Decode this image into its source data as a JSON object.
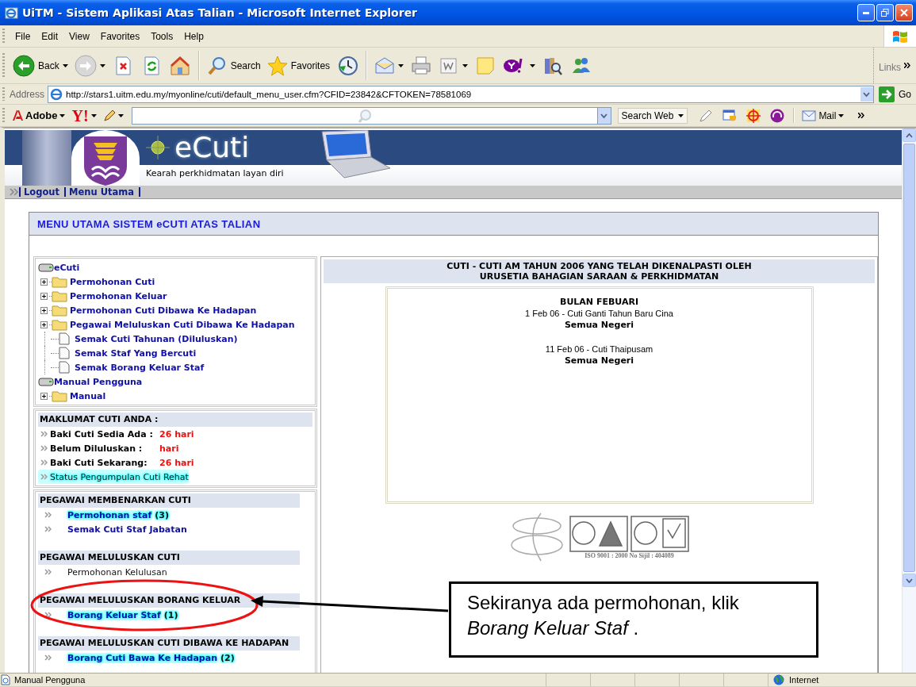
{
  "window": {
    "title": "UiTM - Sistem Aplikasi Atas Talian - Microsoft Internet Explorer"
  },
  "menu_bar": [
    "File",
    "Edit",
    "View",
    "Favorites",
    "Tools",
    "Help"
  ],
  "toolbar": {
    "back": "Back",
    "search": "Search",
    "favorites": "Favorites",
    "links": "Links"
  },
  "address_bar": {
    "label": "Address",
    "url": "http://stars1.uitm.edu.my/myonline/cuti/default_menu_user.cfm?CFID=23842&CFTOKEN=78581069",
    "go": "Go"
  },
  "search_toolbar": {
    "adobe": "Adobe",
    "yahoo": "Y!",
    "search_button": "Search Web",
    "mail": "Mail"
  },
  "banner": {
    "title": "eCuti",
    "tagline": "Kearah perkhidmatan layan diri"
  },
  "nav_links": [
    "Logout",
    "Menu Utama"
  ],
  "main": {
    "heading": "MENU UTAMA SISTEM eCUTI ATAS TALIAN"
  },
  "tree": [
    {
      "label": "eCuti",
      "kind": "drive",
      "children": [
        {
          "label": "Permohonan Cuti",
          "kind": "folder",
          "expanded": false
        },
        {
          "label": "Permohonan Keluar",
          "kind": "folder",
          "expanded": false
        },
        {
          "label": "Permohonan Cuti Dibawa Ke Hadapan",
          "kind": "folder",
          "expanded": false
        },
        {
          "label": "Pegawai Meluluskan Cuti Dibawa Ke Hadapan",
          "kind": "folder",
          "expanded": false
        },
        {
          "label": "Semak Cuti Tahunan (Diluluskan)",
          "kind": "page"
        },
        {
          "label": "Semak Staf Yang Bercuti",
          "kind": "page"
        },
        {
          "label": "Semak Borang Keluar Staf",
          "kind": "page"
        }
      ]
    },
    {
      "label": "Manual Pengguna",
      "kind": "drive",
      "children": [
        {
          "label": "Manual",
          "kind": "folder",
          "expanded": false
        }
      ]
    }
  ],
  "leave_info": {
    "heading": "MAKLUMAT CUTI ANDA :",
    "rows": [
      {
        "label": "Baki Cuti Sedia Ada :",
        "value": "26 hari"
      },
      {
        "label": "Belum Diluluskan :",
        "value": "hari"
      },
      {
        "label": "Baki Cuti Sekarang:",
        "value": "26 hari"
      }
    ],
    "link": "Status Pengumpulan Cuti Rehat"
  },
  "approver_sections": [
    {
      "heading": "PEGAWAI MEMBENARKAN CUTI",
      "items": [
        {
          "label": "Permohonan staf",
          "count": "(3)",
          "kind": "link",
          "highlighted": true
        },
        {
          "label": "Semak Cuti Staf Jabatan",
          "kind": "link",
          "highlighted": false
        }
      ]
    },
    {
      "heading": "PEGAWAI MELULUSKAN CUTI",
      "items": [
        {
          "label": "Permohonan Kelulusan",
          "kind": "plain",
          "highlighted": false
        }
      ]
    },
    {
      "heading": "PEGAWAI MELULUSKAN BORANG KELUAR",
      "items": [
        {
          "label": "Borang Keluar Staf",
          "count": "(1)",
          "kind": "link",
          "highlighted": true
        }
      ]
    },
    {
      "heading": "PEGAWAI MELULUSKAN CUTI DIBAWA KE HADAPAN",
      "items": [
        {
          "label": "Borang Cuti Bawa Ke Hadapan",
          "count": "(2)",
          "kind": "link",
          "highlighted": true
        }
      ]
    }
  ],
  "holidays": {
    "heading_lines": [
      "CUTI - CUTI AM TAHUN 2006 YANG TELAH DIKENALPASTI OLEH",
      "URUSETIA BAHAGIAN SARAAN & PERKHIDMATAN"
    ],
    "month": "BULAN FEBUARI",
    "entries": [
      {
        "description": "1 Feb 06 - Cuti Ganti Tahun Baru Cina",
        "scope": "Semua Negeri"
      },
      {
        "description": "11 Feb 06 - Cuti Thaipusam",
        "scope": "Semua Negeri"
      }
    ],
    "certification": "ISO 9001 : 2000   No Sijil : 404089"
  },
  "callout": {
    "text": "Sekiranya ada permohonan, klik *Borang Keluar Staf* ."
  },
  "status_bar": {
    "text": "Manual Pengguna",
    "zone": "Internet"
  }
}
